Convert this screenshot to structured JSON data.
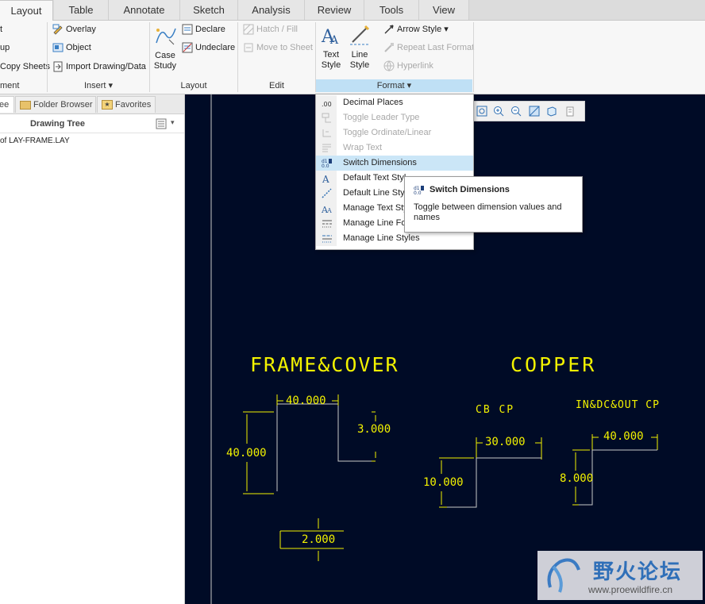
{
  "tabs": [
    "Layout",
    "Table",
    "Annotate",
    "Sketch",
    "Analysis",
    "Review",
    "Tools",
    "View"
  ],
  "ribbon": {
    "partial_items": [
      "t",
      "up",
      "Copy Sheets"
    ],
    "group_partial_label": "ment",
    "insert": {
      "items": [
        "Overlay",
        "Object",
        "Import Drawing/Data"
      ],
      "label": "Insert"
    },
    "layout": {
      "case_study": [
        "Case",
        "Study"
      ],
      "declare": "Declare",
      "undeclare": "Undeclare",
      "label": "Layout"
    },
    "edit": {
      "hatch": "Hatch / Fill",
      "move": "Move to Sheet",
      "label": "Edit"
    },
    "format": {
      "text_style": [
        "Text",
        "Style"
      ],
      "line_style": [
        "Line",
        "Style"
      ],
      "arrow_style": "Arrow Style",
      "repeat": "Repeat Last Format",
      "hyperlink": "Hyperlink",
      "label": "Format"
    }
  },
  "left_panel": {
    "tabs": [
      "ee",
      "Folder Browser",
      "Favorites"
    ],
    "header": "Drawing Tree",
    "tree_item": "of LAY-FRAME.LAY"
  },
  "menu": {
    "items": [
      {
        "label": "Decimal Places",
        "enabled": true
      },
      {
        "label": "Toggle Leader Type",
        "enabled": false
      },
      {
        "label": "Toggle Ordinate/Linear",
        "enabled": false
      },
      {
        "label": "Wrap Text",
        "enabled": false
      },
      {
        "label": "Switch Dimensions",
        "enabled": true,
        "highlighted": true
      },
      {
        "label": "Default Text Styl",
        "enabled": true
      },
      {
        "label": "Default Line Styl",
        "enabled": true
      },
      {
        "label": "Manage Text Sty",
        "enabled": true
      },
      {
        "label": "Manage Line Fo",
        "enabled": true
      },
      {
        "label": "Manage Line Styles",
        "enabled": true
      }
    ]
  },
  "tooltip": {
    "title": "Switch Dimensions",
    "body": "Toggle between dimension values and names"
  },
  "drawing": {
    "frame_title": "FRAME&COVER",
    "copper_title": "COPPER",
    "cb_cp": "CB CP",
    "in_out_cp": "IN&DC&OUT CP",
    "dims": {
      "d1": "40.000",
      "d2": "3.000",
      "d3": "40.000",
      "d4": "2.000",
      "d5": "30.000",
      "d6": "10.000",
      "d7": "40.000",
      "d8": "8.000"
    }
  },
  "watermark": {
    "title": "野火论坛",
    "url": "www.proewildfire.cn"
  },
  "colors": {
    "canvas": "#000b26",
    "dimension": "#f2f200",
    "geometry": "#c8c8c8",
    "menu_highlight": "#cbe6f7"
  }
}
